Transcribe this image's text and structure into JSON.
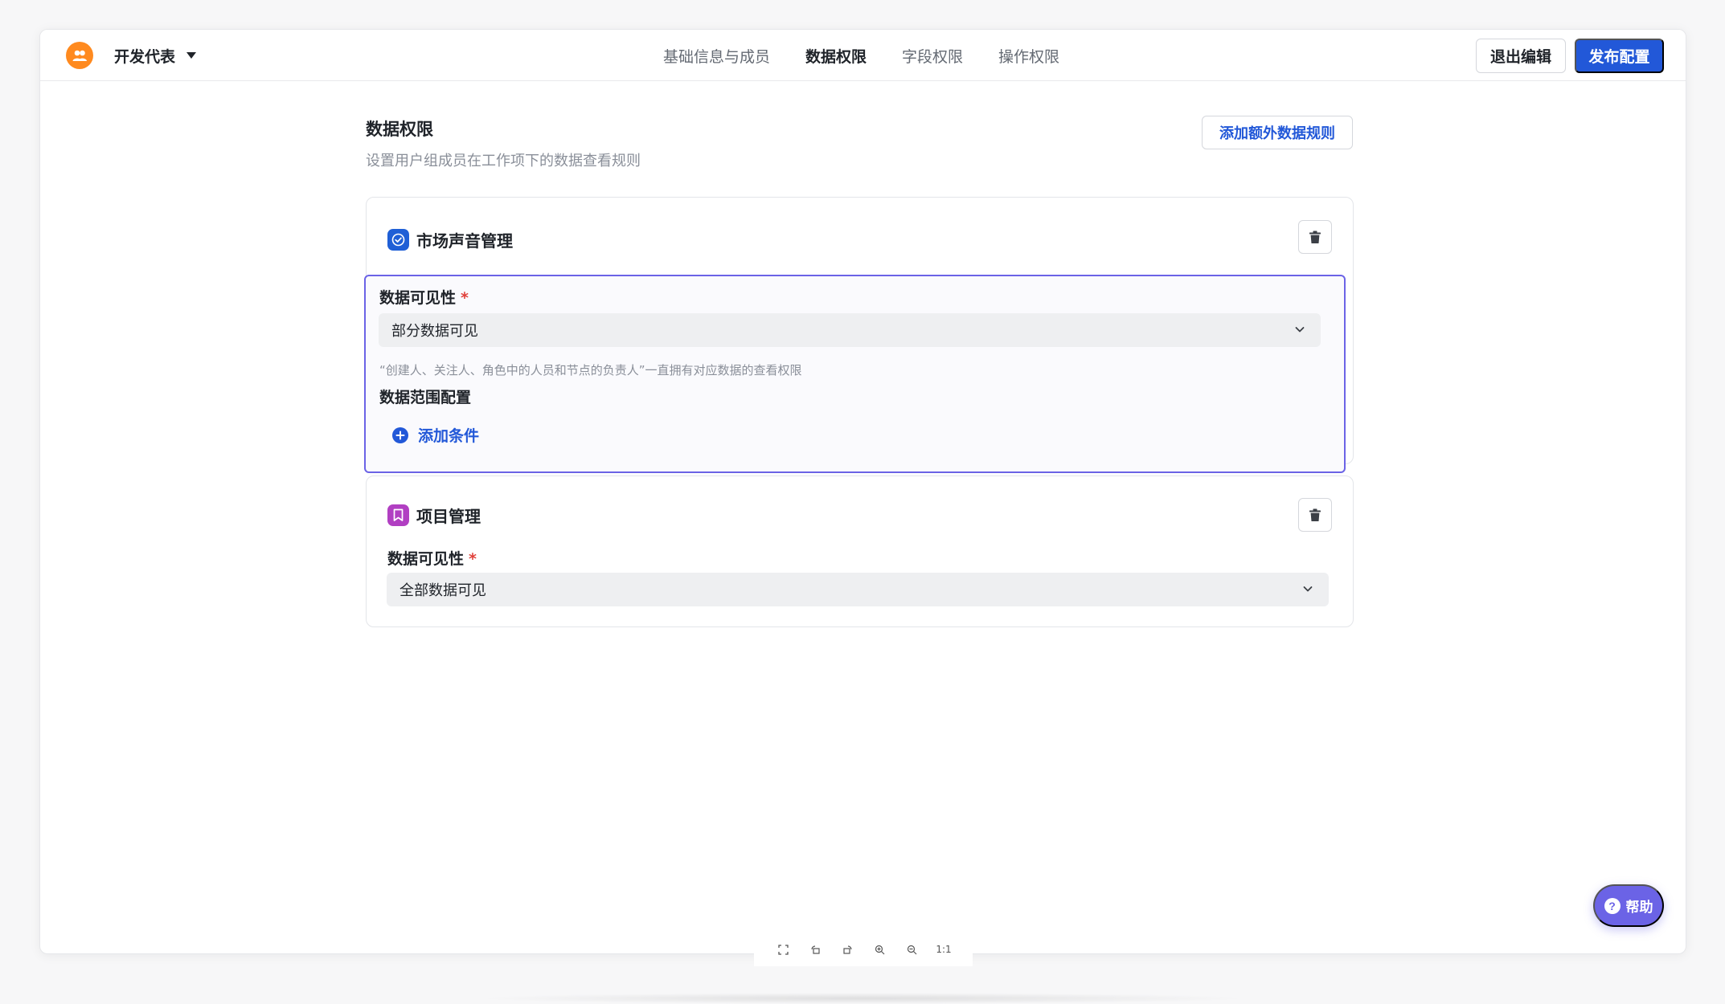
{
  "header": {
    "team_name": "开发代表",
    "tabs": [
      {
        "label": "基础信息与成员",
        "active": false
      },
      {
        "label": "数据权限",
        "active": true
      },
      {
        "label": "字段权限",
        "active": false
      },
      {
        "label": "操作权限",
        "active": false
      }
    ],
    "exit_label": "退出编辑",
    "publish_label": "发布配置"
  },
  "main": {
    "title": "数据权限",
    "description": "设置用户组成员在工作项下的数据查看规则",
    "add_rule_label": "添加额外数据规则",
    "cards": [
      {
        "title": "市场声音管理",
        "icon": "check-circle-icon",
        "visibility_label": "数据可见性",
        "required_mark": "*",
        "visibility_value": "部分数据可见",
        "hint": "“创建人、关注人、角色中的人员和节点的负责人”一直拥有对应数据的查看权限",
        "range_label": "数据范围配置",
        "add_condition_label": "添加条件"
      },
      {
        "title": "项目管理",
        "icon": "bookmark-icon",
        "visibility_label": "数据可见性",
        "required_mark": "*",
        "visibility_value": "全部数据可见"
      }
    ]
  },
  "help": {
    "label": "帮助"
  },
  "viewer_toolbar": {
    "zoom_reset_label": "1:1"
  },
  "colors": {
    "primary": "#2258d8",
    "accent_purple": "#6b63e6",
    "team_avatar": "#ff8a1f",
    "required": "#e0403a"
  }
}
